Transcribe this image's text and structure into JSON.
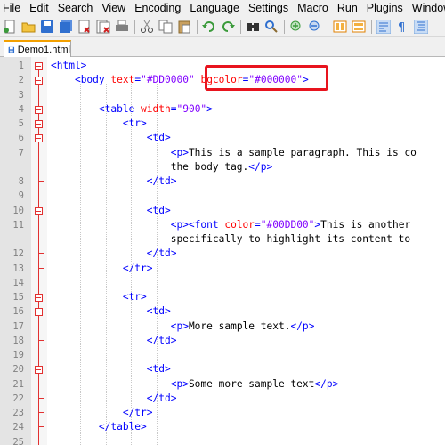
{
  "menu": [
    "File",
    "Edit",
    "Search",
    "View",
    "Encoding",
    "Language",
    "Settings",
    "Macro",
    "Run",
    "Plugins",
    "Window"
  ],
  "toolbar": {
    "groups": [
      [
        "new-file-icon",
        "open-file-icon",
        "save-icon",
        "save-all-icon",
        "close-icon",
        "close-all-icon",
        "print-icon"
      ],
      [
        "cut-icon",
        "copy-icon",
        "paste-icon"
      ],
      [
        "undo-icon",
        "redo-icon"
      ],
      [
        "find-icon",
        "replace-icon"
      ],
      [
        "zoom-in-icon",
        "zoom-out-icon"
      ],
      [
        "sync-vertical-icon",
        "sync-horizontal-icon"
      ],
      [
        "word-wrap-icon",
        "show-all-chars-icon",
        "indent-guide-icon"
      ]
    ],
    "colors": {
      "accent": "#f3a000",
      "blue": "#2f6fcf",
      "green": "#3a9a3a"
    }
  },
  "tab": {
    "label": "Demo1.html"
  },
  "editor": {
    "lines": [
      {
        "n": "1",
        "fold": "box",
        "segs": [
          [
            "tag",
            "<html>"
          ]
        ]
      },
      {
        "n": "2",
        "fold": "box",
        "segs": [
          [
            "txt",
            "    "
          ],
          [
            "tag",
            "<body "
          ],
          [
            "attr",
            "text"
          ],
          [
            "tag",
            "="
          ],
          [
            "val",
            "\"#DD0000\""
          ],
          [
            "txt",
            " "
          ],
          [
            "attr",
            "bgcolor"
          ],
          [
            "tag",
            "="
          ],
          [
            "val",
            "\"#000000\""
          ],
          [
            "tag",
            ">"
          ]
        ]
      },
      {
        "n": "3",
        "fold": "",
        "segs": []
      },
      {
        "n": "4",
        "fold": "box",
        "segs": [
          [
            "txt",
            "        "
          ],
          [
            "tag",
            "<table "
          ],
          [
            "attr",
            "width"
          ],
          [
            "tag",
            "="
          ],
          [
            "val",
            "\"900\""
          ],
          [
            "tag",
            ">"
          ]
        ]
      },
      {
        "n": "5",
        "fold": "box",
        "segs": [
          [
            "txt",
            "            "
          ],
          [
            "tag",
            "<tr>"
          ]
        ]
      },
      {
        "n": "6",
        "fold": "box",
        "segs": [
          [
            "txt",
            "                "
          ],
          [
            "tag",
            "<td>"
          ]
        ]
      },
      {
        "n": "7",
        "fold": "",
        "segs": [
          [
            "txt",
            "                    "
          ],
          [
            "tag",
            "<p>"
          ],
          [
            "txt",
            "This is a sample paragraph. This is co"
          ]
        ]
      },
      {
        "n": "",
        "fold": "",
        "segs": [
          [
            "txt",
            "                    the body tag."
          ],
          [
            "tag",
            "</p>"
          ]
        ]
      },
      {
        "n": "8",
        "fold": "end",
        "segs": [
          [
            "txt",
            "                "
          ],
          [
            "tag",
            "</td>"
          ]
        ]
      },
      {
        "n": "9",
        "fold": "",
        "segs": []
      },
      {
        "n": "10",
        "fold": "box",
        "segs": [
          [
            "txt",
            "                "
          ],
          [
            "tag",
            "<td>"
          ]
        ]
      },
      {
        "n": "11",
        "fold": "",
        "segs": [
          [
            "txt",
            "                    "
          ],
          [
            "tag",
            "<p><font "
          ],
          [
            "attr",
            "color"
          ],
          [
            "tag",
            "="
          ],
          [
            "val",
            "\"#00DD00\""
          ],
          [
            "tag",
            ">"
          ],
          [
            "txt",
            "This is another"
          ]
        ]
      },
      {
        "n": "",
        "fold": "",
        "segs": [
          [
            "txt",
            "                    specifically to highlight its content to"
          ]
        ]
      },
      {
        "n": "12",
        "fold": "end",
        "segs": [
          [
            "txt",
            "                "
          ],
          [
            "tag",
            "</td>"
          ]
        ]
      },
      {
        "n": "13",
        "fold": "end",
        "segs": [
          [
            "txt",
            "            "
          ],
          [
            "tag",
            "</tr>"
          ]
        ]
      },
      {
        "n": "14",
        "fold": "",
        "segs": []
      },
      {
        "n": "15",
        "fold": "box",
        "segs": [
          [
            "txt",
            "            "
          ],
          [
            "tag",
            "<tr>"
          ]
        ]
      },
      {
        "n": "16",
        "fold": "box",
        "segs": [
          [
            "txt",
            "                "
          ],
          [
            "tag",
            "<td>"
          ]
        ]
      },
      {
        "n": "17",
        "fold": "",
        "segs": [
          [
            "txt",
            "                    "
          ],
          [
            "tag",
            "<p>"
          ],
          [
            "txt",
            "More sample text."
          ],
          [
            "tag",
            "</p>"
          ]
        ]
      },
      {
        "n": "18",
        "fold": "end",
        "segs": [
          [
            "txt",
            "                "
          ],
          [
            "tag",
            "</td>"
          ]
        ]
      },
      {
        "n": "19",
        "fold": "",
        "segs": []
      },
      {
        "n": "20",
        "fold": "box",
        "segs": [
          [
            "txt",
            "                "
          ],
          [
            "tag",
            "<td>"
          ]
        ]
      },
      {
        "n": "21",
        "fold": "",
        "segs": [
          [
            "txt",
            "                    "
          ],
          [
            "tag",
            "<p>"
          ],
          [
            "txt",
            "Some more sample text"
          ],
          [
            "tag",
            "</p>"
          ]
        ]
      },
      {
        "n": "22",
        "fold": "end",
        "segs": [
          [
            "txt",
            "                "
          ],
          [
            "tag",
            "</td>"
          ]
        ]
      },
      {
        "n": "23",
        "fold": "end",
        "segs": [
          [
            "txt",
            "            "
          ],
          [
            "tag",
            "</tr>"
          ]
        ]
      },
      {
        "n": "24",
        "fold": "end",
        "segs": [
          [
            "txt",
            "        "
          ],
          [
            "tag",
            "</table>"
          ]
        ]
      },
      {
        "n": "25",
        "fold": "",
        "segs": []
      }
    ]
  }
}
